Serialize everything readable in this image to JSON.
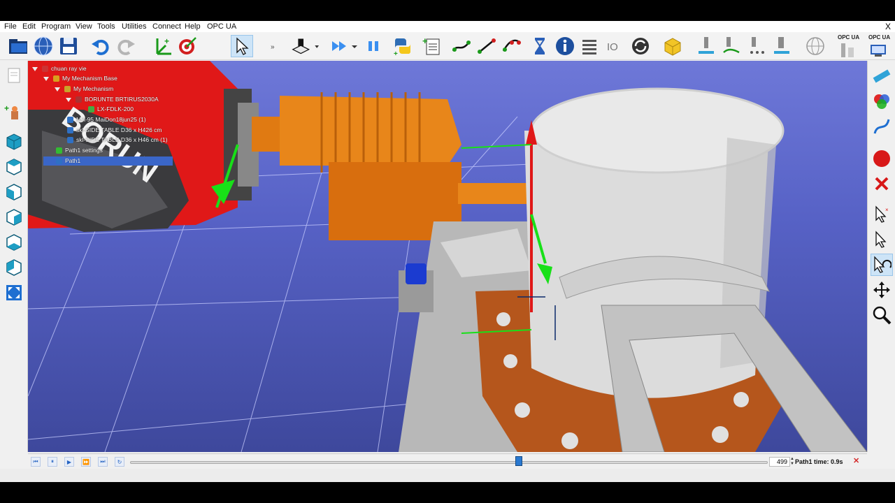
{
  "menu": {
    "items": [
      "File",
      "Edit",
      "Program",
      "View",
      "Tools",
      "Utilities",
      "Connect",
      "Help",
      "OPC UA"
    ],
    "close_glyph": "X"
  },
  "toolbar": {
    "opc_labels": [
      "OPC UA",
      "OPC UA"
    ],
    "icons": [
      "open-folder-icon",
      "globe-icon",
      "save-icon",
      "undo-icon",
      "redo-icon",
      "add-frame-icon",
      "target-icon",
      "select-arrow-icon",
      "more-icon",
      "stl-tool-icon",
      "play-icon",
      "pause-icon",
      "python-icon",
      "add-program-icon",
      "move-joints-icon",
      "move-linear-icon",
      "move-circular-icon",
      "pause-timer-icon",
      "info-icon",
      "program-call-icon",
      "io-icon",
      "sync-icon",
      "export-icon",
      "machining-icon",
      "curve-follow-icon",
      "point-follow-icon",
      "spindle-icon",
      "network-icon",
      "opc-server-icon",
      "opc-client-icon"
    ]
  },
  "tree": {
    "items": [
      {
        "label": "chuan ray vie",
        "level": 0,
        "icon_color": "#c33"
      },
      {
        "label": "My Mechanism Base",
        "level": 1,
        "icon_color": "#d8a11e"
      },
      {
        "label": "My Mechanism",
        "level": 2,
        "icon_color": "#c9a42a"
      },
      {
        "label": "BORUNTE BRTIRUS2030A",
        "level": 3,
        "icon_color": "#a33"
      },
      {
        "label": "LX-FDLK-200",
        "level": 4,
        "icon_color": "#4a4"
      },
      {
        "label": "MA-95 MaiDon18jun25 (1)",
        "level": 2,
        "icon_color": "#2f70c4"
      },
      {
        "label": "skl-SIDE TABLE D36 x H426 cm",
        "level": 2,
        "icon_color": "#2f70c4"
      },
      {
        "label": "skl-SIDE TABLE D36 x H46 cm (1)",
        "level": 2,
        "icon_color": "#2f70c4"
      },
      {
        "label": "Path1 settings",
        "level": 1,
        "icon_color": "#3b3"
      },
      {
        "label": "Path1",
        "level": 1,
        "icon_color": "#2f70c4"
      }
    ],
    "selected": "Path1"
  },
  "scene": {
    "robot_brand_text": "BORUN"
  },
  "timeline": {
    "frame": "499",
    "path_time": "Path1 time: 0.9s",
    "progress": 0.61,
    "stop_glyph": "✕"
  },
  "colors": {
    "viewport_top": "#6e78d8",
    "robot_red": "#e01818",
    "gripper_orange": "#e07a12",
    "plate_brown": "#b5561c",
    "accent_blue": "#2a79d0"
  }
}
